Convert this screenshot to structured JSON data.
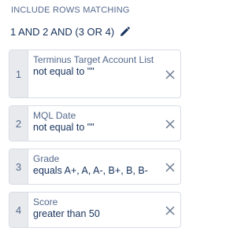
{
  "header": {
    "title": "INCLUDE ROWS MATCHING",
    "logic": "1 AND 2 AND (3 OR 4)",
    "edit_icon": "pencil-icon"
  },
  "filters": [
    {
      "number": "1",
      "field": "Terminus Target Account List",
      "condition": "not equal to \"\""
    },
    {
      "number": "2",
      "field": "MQL Date",
      "condition": "not equal to \"\""
    },
    {
      "number": "3",
      "field": "Grade",
      "condition": "equals A+, A, A-, B+, B, B-"
    },
    {
      "number": "4",
      "field": "Score",
      "condition": "greater than 50"
    }
  ],
  "icons": {
    "remove": "close-icon"
  },
  "colors": {
    "label": "#54698d",
    "text": "#16325c",
    "number_bg": "#e8eaed",
    "border": "#d8dde6"
  }
}
